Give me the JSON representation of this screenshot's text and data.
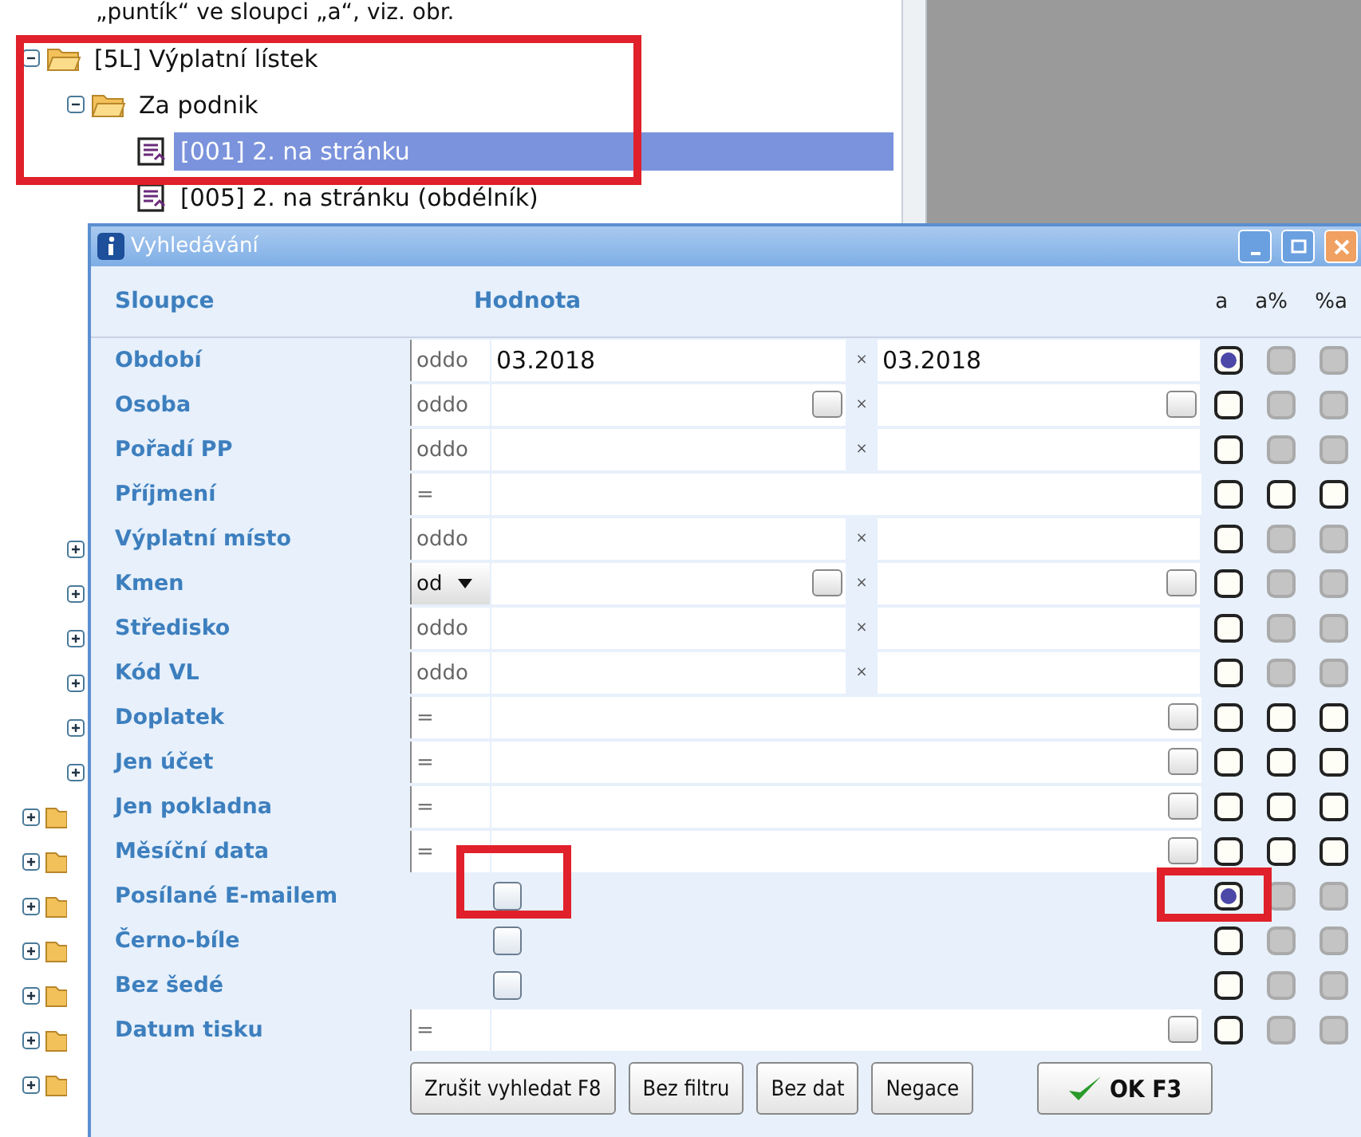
{
  "caption": "„puntík“ ve sloupci „a“, viz. obr.",
  "tree": {
    "items": [
      {
        "label": "[5L] Výplatní lístek",
        "kind": "folder",
        "expanded": true,
        "selected": false,
        "children": [
          {
            "label": "Za podnik",
            "kind": "folder",
            "expanded": true,
            "selected": false,
            "children": [
              {
                "label": "[001] 2. na stránku",
                "kind": "report",
                "selected": true
              },
              {
                "label": "[005] 2. na stránku (obdélník)",
                "kind": "report",
                "selected": false
              }
            ]
          }
        ]
      }
    ]
  },
  "dialog": {
    "title": "Vyhledávání",
    "columns": {
      "label": "Sloupce",
      "value": "Hodnota",
      "modes": [
        "a",
        "a%",
        "%a"
      ]
    },
    "rows": [
      {
        "label": "Období",
        "kind": "range",
        "op": "oddo",
        "from": "03.2018",
        "separator": "×",
        "to": "03.2018",
        "browse": false,
        "modes": [
          {
            "selected": true,
            "disabled": false
          },
          {
            "selected": false,
            "disabled": true
          },
          {
            "selected": false,
            "disabled": true
          }
        ]
      },
      {
        "label": "Osoba",
        "kind": "range",
        "op": "oddo",
        "separator": "×",
        "browse": true,
        "modes": [
          {
            "selected": false,
            "disabled": false
          },
          {
            "selected": false,
            "disabled": true
          },
          {
            "selected": false,
            "disabled": true
          }
        ]
      },
      {
        "label": "Pořadí PP",
        "kind": "range",
        "op": "oddo",
        "separator": "×",
        "browse": false,
        "modes": [
          {
            "selected": false,
            "disabled": false
          },
          {
            "selected": false,
            "disabled": true
          },
          {
            "selected": false,
            "disabled": true
          }
        ]
      },
      {
        "label": "Příjmení",
        "kind": "single",
        "op": "=",
        "browse": false,
        "modes": [
          {
            "selected": false,
            "disabled": false
          },
          {
            "selected": false,
            "disabled": false
          },
          {
            "selected": false,
            "disabled": false
          }
        ]
      },
      {
        "label": "Výplatní místo",
        "kind": "range",
        "op": "oddo",
        "separator": "×",
        "browse": false,
        "modes": [
          {
            "selected": false,
            "disabled": false
          },
          {
            "selected": false,
            "disabled": true
          },
          {
            "selected": false,
            "disabled": true
          }
        ]
      },
      {
        "label": "Kmen",
        "kind": "range",
        "op": "od",
        "op_dropdown": true,
        "separator": "×",
        "browse": true,
        "modes": [
          {
            "selected": false,
            "disabled": false
          },
          {
            "selected": false,
            "disabled": true
          },
          {
            "selected": false,
            "disabled": true
          }
        ]
      },
      {
        "label": "Středisko",
        "kind": "range",
        "op": "oddo",
        "separator": "×",
        "browse": false,
        "modes": [
          {
            "selected": false,
            "disabled": false
          },
          {
            "selected": false,
            "disabled": true
          },
          {
            "selected": false,
            "disabled": true
          }
        ]
      },
      {
        "label": "Kód VL",
        "kind": "range",
        "op": "oddo",
        "separator": "×",
        "browse": false,
        "modes": [
          {
            "selected": false,
            "disabled": false
          },
          {
            "selected": false,
            "disabled": true
          },
          {
            "selected": false,
            "disabled": true
          }
        ]
      },
      {
        "label": "Doplatek",
        "kind": "single",
        "op": "=",
        "browse": true,
        "modes": [
          {
            "selected": false,
            "disabled": false
          },
          {
            "selected": false,
            "disabled": false
          },
          {
            "selected": false,
            "disabled": false
          }
        ]
      },
      {
        "label": "Jen účet",
        "kind": "single",
        "op": "=",
        "browse": true,
        "modes": [
          {
            "selected": false,
            "disabled": false
          },
          {
            "selected": false,
            "disabled": false
          },
          {
            "selected": false,
            "disabled": false
          }
        ]
      },
      {
        "label": "Jen pokladna",
        "kind": "single",
        "op": "=",
        "browse": true,
        "modes": [
          {
            "selected": false,
            "disabled": false
          },
          {
            "selected": false,
            "disabled": false
          },
          {
            "selected": false,
            "disabled": false
          }
        ]
      },
      {
        "label": "Měsíční data",
        "kind": "single",
        "op": "=",
        "browse": true,
        "modes": [
          {
            "selected": false,
            "disabled": false
          },
          {
            "selected": false,
            "disabled": false
          },
          {
            "selected": false,
            "disabled": false
          }
        ]
      },
      {
        "label": "Posílané E-mailem",
        "kind": "checkbox",
        "checked": false,
        "highlighted": true,
        "modes": [
          {
            "selected": true,
            "disabled": false
          },
          {
            "selected": false,
            "disabled": true
          },
          {
            "selected": false,
            "disabled": true
          }
        ]
      },
      {
        "label": "Černo-bíle",
        "kind": "checkbox",
        "checked": false,
        "modes": [
          {
            "selected": false,
            "disabled": false
          },
          {
            "selected": false,
            "disabled": true
          },
          {
            "selected": false,
            "disabled": true
          }
        ]
      },
      {
        "label": "Bez šedé",
        "kind": "checkbox",
        "checked": false,
        "modes": [
          {
            "selected": false,
            "disabled": false
          },
          {
            "selected": false,
            "disabled": true
          },
          {
            "selected": false,
            "disabled": true
          }
        ]
      },
      {
        "label": "Datum tisku",
        "kind": "single",
        "op": "=",
        "browse": true,
        "modes": [
          {
            "selected": false,
            "disabled": false
          },
          {
            "selected": false,
            "disabled": true
          },
          {
            "selected": false,
            "disabled": true
          }
        ]
      }
    ],
    "buttons": [
      {
        "label": "Zrušit vyhledat F8",
        "kind": "plain"
      },
      {
        "label": "Bez filtru",
        "kind": "plain"
      },
      {
        "label": "Bez dat",
        "kind": "plain"
      },
      {
        "label": "Negace",
        "kind": "plain"
      },
      {
        "label": "OK F3",
        "kind": "ok"
      }
    ]
  }
}
